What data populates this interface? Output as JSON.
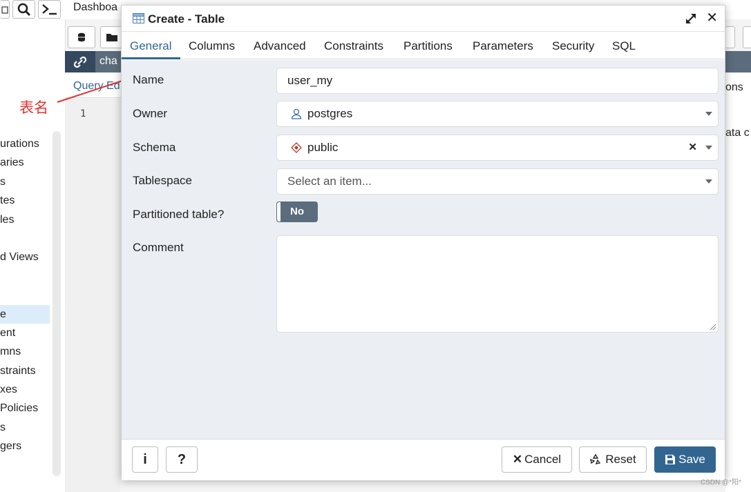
{
  "background": {
    "top_tabs_text": "Dashboa",
    "tree_items": [
      "urations",
      "aries",
      "s",
      "tes",
      "les",
      "",
      "d Views",
      "",
      "",
      "e",
      "ent",
      "mns",
      "straints",
      "xes",
      "Policies",
      "s",
      "gers"
    ],
    "tree_selected_index": 9,
    "darkbar_text": "cha",
    "query_tab_label": "Query Ed",
    "line_number": "1",
    "right_text_1": "ons",
    "right_text_2": "ata c"
  },
  "annotation": {
    "label": "表名",
    "color": "#e8302c"
  },
  "dialog": {
    "title": "Create - Table",
    "tabs": [
      {
        "label": "General",
        "active": true
      },
      {
        "label": "Columns",
        "active": false
      },
      {
        "label": "Advanced",
        "active": false
      },
      {
        "label": "Constraints",
        "active": false
      },
      {
        "label": "Partitions",
        "active": false
      },
      {
        "label": "Parameters",
        "active": false
      },
      {
        "label": "Security",
        "active": false
      },
      {
        "label": "SQL",
        "active": false
      }
    ],
    "fields": {
      "name": {
        "label": "Name",
        "value": "user_my"
      },
      "owner": {
        "label": "Owner",
        "value": "postgres",
        "icon": "user-icon"
      },
      "schema": {
        "label": "Schema",
        "value": "public",
        "icon": "schema-icon"
      },
      "tablespace": {
        "label": "Tablespace",
        "placeholder": "Select an item..."
      },
      "partitioned": {
        "label": "Partitioned table?",
        "value": "No"
      },
      "comment": {
        "label": "Comment",
        "value": ""
      }
    },
    "footer": {
      "info_label": "i",
      "help_label": "?",
      "cancel_label": "Cancel",
      "reset_label": "Reset",
      "save_label": "Save"
    },
    "accent_color": "#326690"
  },
  "watermark": "CSDN @*阳*"
}
